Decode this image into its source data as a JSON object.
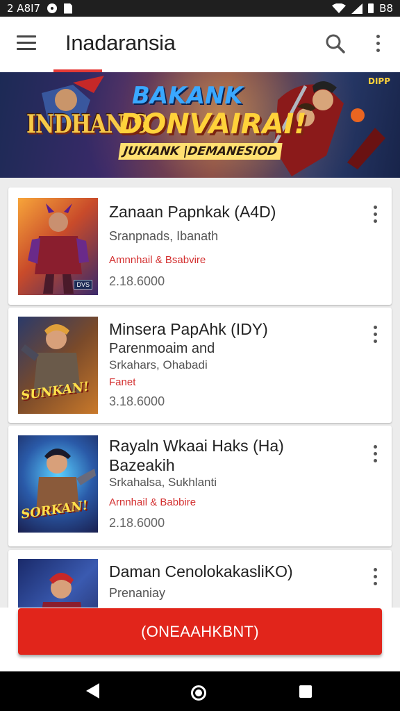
{
  "status_bar": {
    "time": "2 A8I7",
    "battery": "B8",
    "icons": [
      "record-icon",
      "sim-card-icon",
      "wifi-icon",
      "signal-icon",
      "battery-icon"
    ]
  },
  "app_bar": {
    "title": "Inadaransia",
    "icons": [
      "menu-icon",
      "search-icon",
      "more-vert-icon"
    ]
  },
  "banner": {
    "logo_text": "INDHANIS",
    "title_line1": "BAKANK",
    "title_line2": "DONVAIRAI!",
    "subtitle": "JUKIANK |DEMANESIOD",
    "corner_text": "DIPP"
  },
  "items": [
    {
      "title": "Zanaan Papnkak (A4D)",
      "line1": "Sranpnads, Ibanath",
      "line2": "",
      "red": "Amnnhail & Bsabvire",
      "number": "2.18.6000",
      "thumb_label": "",
      "thumb_badge": "DVS"
    },
    {
      "title": "Minsera PapAhk (IDY)",
      "line1": "Parenmoaim and",
      "line2": "Srkahars, Ohabadi",
      "red": "Fanet",
      "number": "3.18.6000",
      "thumb_label": "SUNKAN!",
      "thumb_badge": ""
    },
    {
      "title": "Rayaln Wkaai Haks (Ha)",
      "line1": "Bazeakih",
      "line2": "Srkahalsa, Sukhlanti",
      "red": "Arnnhail & Babbire",
      "number": "2.18.6000",
      "thumb_label": "SORKAN!",
      "thumb_badge": ""
    },
    {
      "title": "Daman CenolokakasliKO)",
      "line1": "Prenaniay",
      "line2": "",
      "red": "",
      "number": "",
      "thumb_label": "",
      "thumb_badge": ""
    }
  ],
  "cta": {
    "label": "(ONEAAHKBNT)"
  },
  "colors": {
    "accent": "#e53935",
    "cta": "#e1251b",
    "red_text": "#d32f2f"
  }
}
